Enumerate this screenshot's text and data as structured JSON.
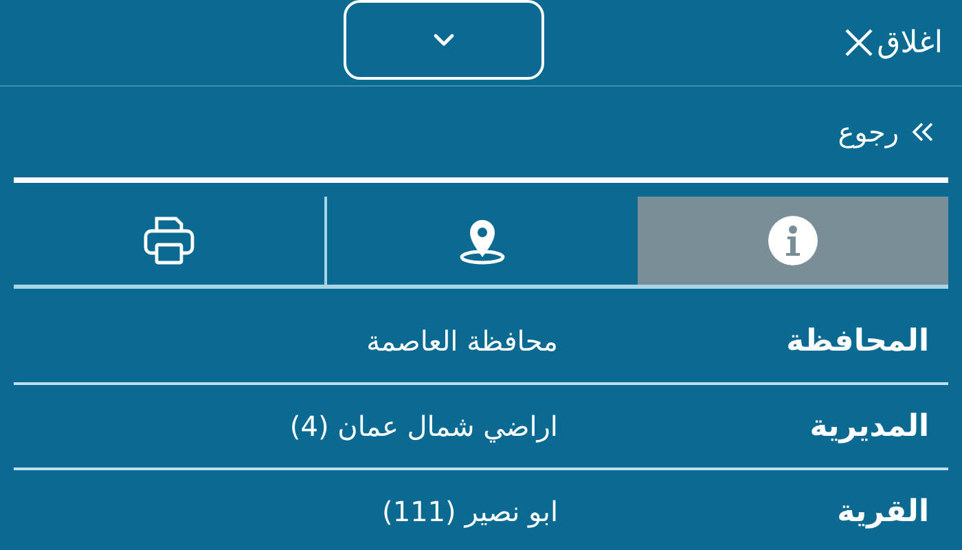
{
  "header": {
    "close_label": "اغلاق"
  },
  "back": {
    "label": "رجوع"
  },
  "tabs": [
    {
      "kind": "info",
      "selected": true
    },
    {
      "kind": "location",
      "selected": false
    },
    {
      "kind": "print",
      "selected": false
    }
  ],
  "details": [
    {
      "label": "المحافظة",
      "value": "محافظة العاصمة"
    },
    {
      "label": "المديرية",
      "value": "اراضي شمال عمان (4)"
    },
    {
      "label": "القرية",
      "value": "ابو نصير (111)"
    }
  ]
}
